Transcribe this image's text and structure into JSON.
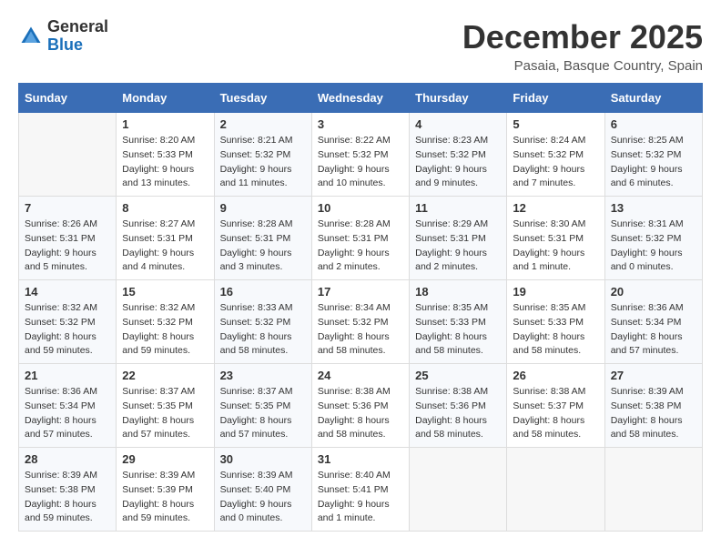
{
  "header": {
    "logo_general": "General",
    "logo_blue": "Blue",
    "month_title": "December 2025",
    "location": "Pasaia, Basque Country, Spain"
  },
  "weekdays": [
    "Sunday",
    "Monday",
    "Tuesday",
    "Wednesday",
    "Thursday",
    "Friday",
    "Saturday"
  ],
  "weeks": [
    [
      {
        "day": "",
        "info": ""
      },
      {
        "day": "1",
        "info": "Sunrise: 8:20 AM\nSunset: 5:33 PM\nDaylight: 9 hours\nand 13 minutes."
      },
      {
        "day": "2",
        "info": "Sunrise: 8:21 AM\nSunset: 5:32 PM\nDaylight: 9 hours\nand 11 minutes."
      },
      {
        "day": "3",
        "info": "Sunrise: 8:22 AM\nSunset: 5:32 PM\nDaylight: 9 hours\nand 10 minutes."
      },
      {
        "day": "4",
        "info": "Sunrise: 8:23 AM\nSunset: 5:32 PM\nDaylight: 9 hours\nand 9 minutes."
      },
      {
        "day": "5",
        "info": "Sunrise: 8:24 AM\nSunset: 5:32 PM\nDaylight: 9 hours\nand 7 minutes."
      },
      {
        "day": "6",
        "info": "Sunrise: 8:25 AM\nSunset: 5:32 PM\nDaylight: 9 hours\nand 6 minutes."
      }
    ],
    [
      {
        "day": "7",
        "info": "Sunrise: 8:26 AM\nSunset: 5:31 PM\nDaylight: 9 hours\nand 5 minutes."
      },
      {
        "day": "8",
        "info": "Sunrise: 8:27 AM\nSunset: 5:31 PM\nDaylight: 9 hours\nand 4 minutes."
      },
      {
        "day": "9",
        "info": "Sunrise: 8:28 AM\nSunset: 5:31 PM\nDaylight: 9 hours\nand 3 minutes."
      },
      {
        "day": "10",
        "info": "Sunrise: 8:28 AM\nSunset: 5:31 PM\nDaylight: 9 hours\nand 2 minutes."
      },
      {
        "day": "11",
        "info": "Sunrise: 8:29 AM\nSunset: 5:31 PM\nDaylight: 9 hours\nand 2 minutes."
      },
      {
        "day": "12",
        "info": "Sunrise: 8:30 AM\nSunset: 5:31 PM\nDaylight: 9 hours\nand 1 minute."
      },
      {
        "day": "13",
        "info": "Sunrise: 8:31 AM\nSunset: 5:32 PM\nDaylight: 9 hours\nand 0 minutes."
      }
    ],
    [
      {
        "day": "14",
        "info": "Sunrise: 8:32 AM\nSunset: 5:32 PM\nDaylight: 8 hours\nand 59 minutes."
      },
      {
        "day": "15",
        "info": "Sunrise: 8:32 AM\nSunset: 5:32 PM\nDaylight: 8 hours\nand 59 minutes."
      },
      {
        "day": "16",
        "info": "Sunrise: 8:33 AM\nSunset: 5:32 PM\nDaylight: 8 hours\nand 58 minutes."
      },
      {
        "day": "17",
        "info": "Sunrise: 8:34 AM\nSunset: 5:32 PM\nDaylight: 8 hours\nand 58 minutes."
      },
      {
        "day": "18",
        "info": "Sunrise: 8:35 AM\nSunset: 5:33 PM\nDaylight: 8 hours\nand 58 minutes."
      },
      {
        "day": "19",
        "info": "Sunrise: 8:35 AM\nSunset: 5:33 PM\nDaylight: 8 hours\nand 58 minutes."
      },
      {
        "day": "20",
        "info": "Sunrise: 8:36 AM\nSunset: 5:34 PM\nDaylight: 8 hours\nand 57 minutes."
      }
    ],
    [
      {
        "day": "21",
        "info": "Sunrise: 8:36 AM\nSunset: 5:34 PM\nDaylight: 8 hours\nand 57 minutes."
      },
      {
        "day": "22",
        "info": "Sunrise: 8:37 AM\nSunset: 5:35 PM\nDaylight: 8 hours\nand 57 minutes."
      },
      {
        "day": "23",
        "info": "Sunrise: 8:37 AM\nSunset: 5:35 PM\nDaylight: 8 hours\nand 57 minutes."
      },
      {
        "day": "24",
        "info": "Sunrise: 8:38 AM\nSunset: 5:36 PM\nDaylight: 8 hours\nand 58 minutes."
      },
      {
        "day": "25",
        "info": "Sunrise: 8:38 AM\nSunset: 5:36 PM\nDaylight: 8 hours\nand 58 minutes."
      },
      {
        "day": "26",
        "info": "Sunrise: 8:38 AM\nSunset: 5:37 PM\nDaylight: 8 hours\nand 58 minutes."
      },
      {
        "day": "27",
        "info": "Sunrise: 8:39 AM\nSunset: 5:38 PM\nDaylight: 8 hours\nand 58 minutes."
      }
    ],
    [
      {
        "day": "28",
        "info": "Sunrise: 8:39 AM\nSunset: 5:38 PM\nDaylight: 8 hours\nand 59 minutes."
      },
      {
        "day": "29",
        "info": "Sunrise: 8:39 AM\nSunset: 5:39 PM\nDaylight: 8 hours\nand 59 minutes."
      },
      {
        "day": "30",
        "info": "Sunrise: 8:39 AM\nSunset: 5:40 PM\nDaylight: 9 hours\nand 0 minutes."
      },
      {
        "day": "31",
        "info": "Sunrise: 8:40 AM\nSunset: 5:41 PM\nDaylight: 9 hours\nand 1 minute."
      },
      {
        "day": "",
        "info": ""
      },
      {
        "day": "",
        "info": ""
      },
      {
        "day": "",
        "info": ""
      }
    ]
  ]
}
